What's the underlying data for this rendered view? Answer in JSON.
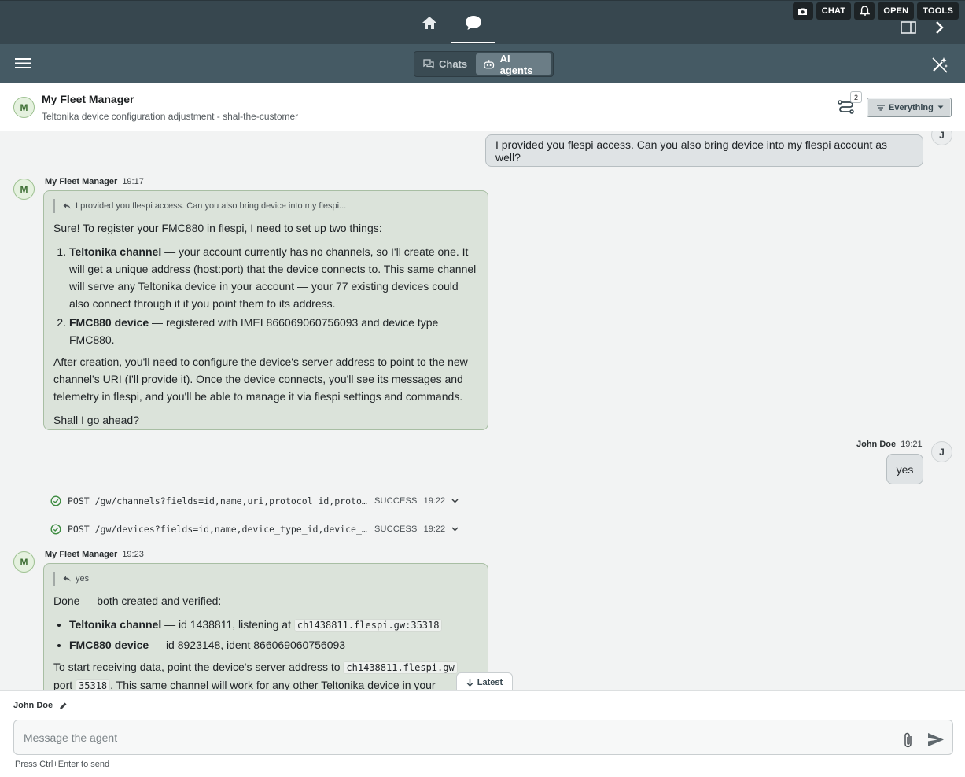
{
  "topbar": {
    "nav": [
      {
        "name": "home-icon"
      },
      {
        "name": "chat-bubble-icon",
        "active": true
      }
    ],
    "tools": {
      "camera": "camera-icon",
      "chat": "CHAT",
      "bell": "bell-icon",
      "open": "OPEN",
      "tools": "TOOLS"
    }
  },
  "subbar": {
    "segments": [
      {
        "label": "Chats",
        "icon": "chats-icon",
        "active": false
      },
      {
        "label": "AI agents",
        "icon": "robot-icon",
        "active": true
      }
    ]
  },
  "header": {
    "avatar": "M",
    "title": "My Fleet Manager",
    "subtitle": "Teltonika device configuration adjustment - shal-the-customer",
    "flows_badge": "2",
    "filter": "Everything"
  },
  "chat": {
    "msg1": {
      "avatar": "J",
      "text": "I provided you flespi access. Can you also bring device into my flespi account as well?"
    },
    "msg2": {
      "avatar": "M",
      "author": "My Fleet Manager",
      "time": "19:17",
      "quote": "I provided you flespi access. Can you also bring device into my flespi...",
      "intro": "Sure! To register your FMC880 in flespi, I need to set up two things:",
      "item1_title": "Teltonika channel",
      "item1_text": " — your account currently has no channels, so I'll create one. It will get a unique address (host:port) that the device connects to. This same channel will serve any Teltonika device in your account — your 77 existing devices could also connect through it if you point them to its address.",
      "item2_title": "FMC880 device",
      "item2_text": " — registered with IMEI 866069060756093 and device type FMC880.",
      "para": "After creation, you'll need to configure the device's server address to point to the new channel's URI (I'll provide it). Once the device connects, you'll see its messages and telemetry in flespi, and you'll be able to manage it via flespi settings and commands.",
      "question": "Shall I go ahead?"
    },
    "msg3": {
      "avatar": "J",
      "author": "John Doe",
      "time": "19:21",
      "text": "yes"
    },
    "tool1": {
      "path": "POST /gw/channels?fields=id,name,uri,protocol_id,protocol_name",
      "status": "SUCCESS",
      "time": "19:22"
    },
    "tool2": {
      "path": "POST /gw/devices?fields=id,name,device_type_id,device_type_name",
      "status": "SUCCESS",
      "time": "19:22"
    },
    "msg4": {
      "avatar": "M",
      "author": "My Fleet Manager",
      "time": "19:23",
      "quote": "yes",
      "intro": "Done — both created and verified:",
      "b1_title": "Teltonika channel",
      "b1_text": " — id 1438811, listening at ",
      "b1_code": "ch1438811.flespi.gw:35318",
      "b2_title": "FMC880 device",
      "b2_text": " — id 8923148, ident 866069060756093",
      "p1": "To start receiving data, point the device's server address to ",
      "p1_code1": "ch1438811.flespi.gw",
      "p1_mid": " port ",
      "p1_code2": "35318",
      "p1_end": ". This same channel will work for any other Teltonika device in your"
    },
    "latest_label": "Latest"
  },
  "composer": {
    "author": "John Doe",
    "placeholder": "Message the agent",
    "value": "",
    "hint": "Press Ctrl+Enter to send"
  },
  "colors": {
    "topbar": "#37474f",
    "subbar": "#455a64",
    "agent_bubble": "#dbe3da",
    "user_bubble": "#dfe3e5",
    "success": "#3d8b40"
  }
}
